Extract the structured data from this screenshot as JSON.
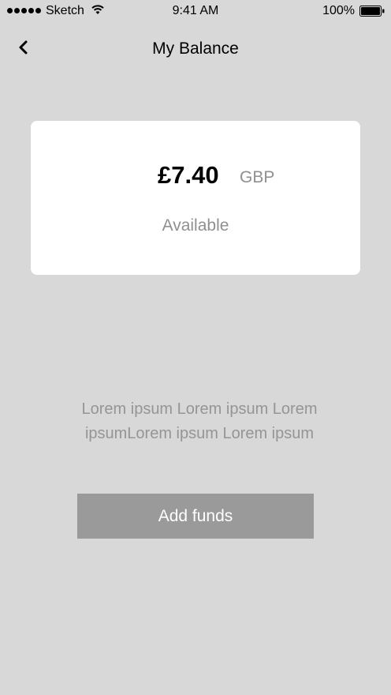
{
  "status_bar": {
    "carrier": "Sketch",
    "time": "9:41 AM",
    "battery": "100%",
    "signal_bars": 5,
    "icons": [
      "signal-icon",
      "wifi-icon",
      "battery-icon"
    ]
  },
  "nav": {
    "title": "My Balance",
    "back_icon": "chevron-left-icon"
  },
  "balance": {
    "amount": "£7.40",
    "currency": "GBP",
    "label": "Available"
  },
  "description": "Lorem ipsum Lorem ipsum Lorem ipsumLorem ipsum Lorem ipsum",
  "actions": {
    "add_funds_label": "Add funds"
  },
  "colors": {
    "background": "#d8d8d8",
    "card": "#ffffff",
    "button": "#9a9a9a",
    "muted_text": "#8f8f8f"
  }
}
